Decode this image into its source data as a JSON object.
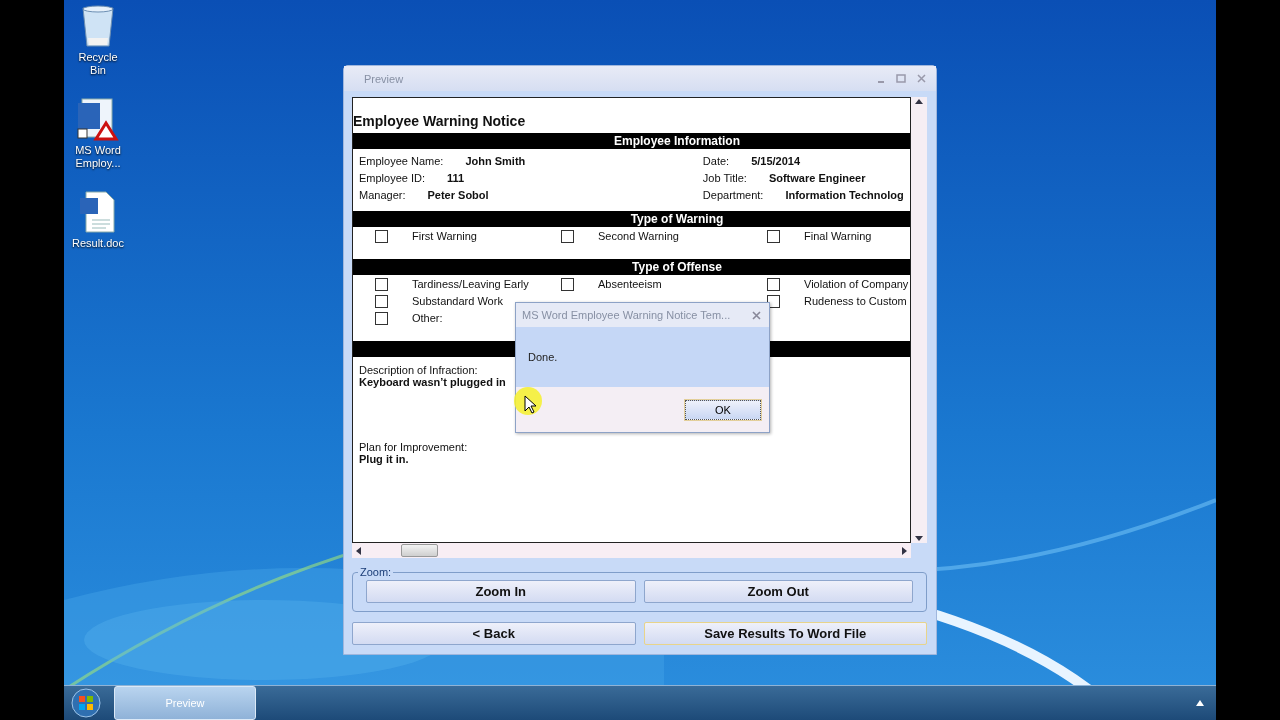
{
  "desktop_icons": [
    {
      "kind": "recycle",
      "label": "Recycle Bin"
    },
    {
      "kind": "app",
      "label": "MS Word Employ..."
    },
    {
      "kind": "doc",
      "label": "Result.doc"
    }
  ],
  "preview_window": {
    "title": "Preview",
    "document": {
      "title": "Employee Warning Notice",
      "sections": [
        {
          "kind": "fields",
          "heading": "Employee Information",
          "rows": [
            [
              {
                "label": "Employee Name:",
                "value": "John Smith"
              },
              {
                "label": "Date:",
                "value": "5/15/2014"
              }
            ],
            [
              {
                "label": "Employee ID:",
                "value": "111"
              },
              {
                "label": "Job Title:",
                "value": "Software Engineer"
              }
            ],
            [
              {
                "label": "Manager:",
                "value": "Peter Sobol"
              },
              {
                "label": "Department:",
                "value": "Information Technolog"
              }
            ]
          ]
        },
        {
          "kind": "checks",
          "heading": "Type of Warning",
          "items": [
            {
              "label": "First Warning",
              "checked": false
            },
            {
              "label": "Second Warning",
              "checked": false
            },
            {
              "label": "Final Warning",
              "checked": false
            }
          ]
        },
        {
          "kind": "checks",
          "heading": "Type of Offense",
          "items": [
            {
              "label": "Tardiness/Leaving Early",
              "checked": false
            },
            {
              "label": "Absenteeism",
              "checked": false
            },
            {
              "label": "Violation of Company",
              "checked": false
            },
            {
              "label": "Substandard Work",
              "checked": false
            },
            {
              "kind": "hidden"
            },
            {
              "label": "Rudeness to Custom",
              "checked": false
            },
            {
              "label": "Other:",
              "checked": false
            }
          ]
        },
        {
          "kind": "notes",
          "items": [
            {
              "label": "Description of Infraction:",
              "value": "Keyboard wasn’t plugged in"
            },
            {
              "label": "Plan for Improvement:",
              "value": "Plug it in."
            }
          ]
        }
      ]
    },
    "zoom_group": {
      "legend": "Zoom:",
      "buttons": [
        "Zoom In",
        "Zoom Out"
      ]
    },
    "buttons": [
      {
        "label": "< Back",
        "focused": false
      },
      {
        "label": "Save Results To Word File",
        "focused": true
      }
    ]
  },
  "dialog": {
    "title": "MS Word Employee Warning Notice Tem...",
    "message": "Done.",
    "button": "OK"
  },
  "taskbar": {
    "tasks": [
      {
        "label": "Preview",
        "selected": true
      }
    ]
  }
}
